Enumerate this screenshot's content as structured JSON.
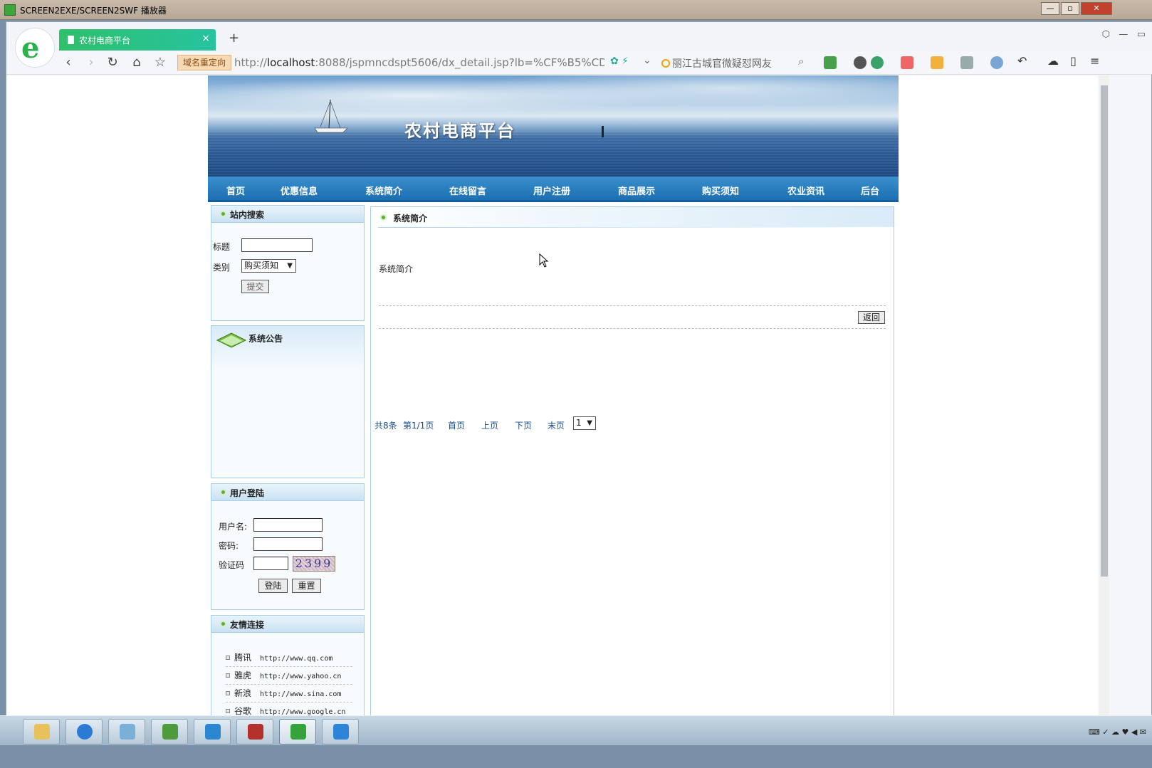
{
  "player": {
    "title": "SCREEN2EXE/SCREEN2SWF 播放器",
    "min": "—",
    "max": "▫",
    "close": "✕"
  },
  "browser": {
    "tab_title": "农村电商平台",
    "tab_close": "×",
    "new_tab": "+",
    "redirect_badge": "域名重定向",
    "url_prefix": "http://",
    "url_host": "localhost",
    "url_rest": ":8088/jspmncdspt5606/dx_detail.jsp?lb=%CF%B5%CD%B3",
    "search_hint": "丽江古城官微疑怼网友",
    "back": "‹",
    "forward": "›",
    "reload": "↻",
    "home": "⌂",
    "favorite": "☆"
  },
  "site": {
    "banner_title": "农村电商平台",
    "nav": [
      "首页",
      "优惠信息",
      "系统简介",
      "在线留言",
      "用户注册",
      "商品展示",
      "购买须知",
      "农业资讯",
      "后台"
    ]
  },
  "search_box": {
    "heading": "站内搜索",
    "title_label": "标题",
    "title_value": "",
    "category_label": "类别",
    "category_selected": "购买须知",
    "submit": "提交"
  },
  "notice_box": {
    "heading": "系统公告"
  },
  "login_box": {
    "heading": "用户登陆",
    "username_label": "用户名:",
    "password_label": "密码:",
    "captcha_label": "验证码",
    "captcha_image_text": "2399",
    "login_button": "登陆",
    "reset_button": "重置"
  },
  "links_box": {
    "heading": "友情连接",
    "items": [
      {
        "name": "腾讯",
        "url": "http://www.qq.com"
      },
      {
        "name": "雅虎",
        "url": "http://www.yahoo.cn"
      },
      {
        "name": "新浪",
        "url": "http://www.sina.com"
      },
      {
        "name": "谷歌",
        "url": "http://www.google.cn"
      }
    ]
  },
  "main": {
    "heading": "系统简介",
    "body": "系统简介",
    "back_button": "返回",
    "pagination": {
      "total": "共8条",
      "page": "第1/1页",
      "first": "首页",
      "prev": "上页",
      "next": "下页",
      "last": "末页",
      "select_value": "1"
    }
  }
}
